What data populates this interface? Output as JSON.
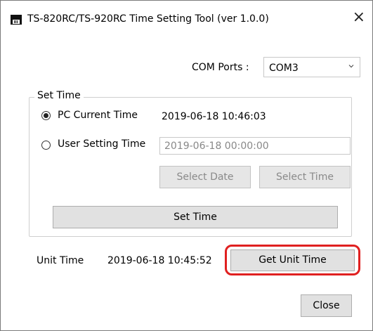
{
  "window": {
    "title": "TS-820RC/TS-920RC Time Setting Tool (ver 1.0.0)",
    "close_glyph": "×"
  },
  "com": {
    "label": "COM Ports :",
    "selected": "COM3"
  },
  "set_time": {
    "legend": "Set Time",
    "pc_current": {
      "label": "PC Current Time",
      "value": "2019-06-18 10:46:03",
      "checked": true
    },
    "user_setting": {
      "label": "User Setting Time",
      "value": "2019-06-18 00:00:00",
      "checked": false
    },
    "select_date_label": "Select Date",
    "select_time_label": "Select Time",
    "set_time_button_label": "Set Time"
  },
  "unit": {
    "label": "Unit Time",
    "value": "2019-06-18 10:45:52",
    "get_button_label": "Get Unit Time"
  },
  "close_button_label": "Close",
  "colors": {
    "highlight": "#e02020"
  },
  "icons": {
    "app": "app-calendar-icon",
    "combo": "chevron-down-icon",
    "close": "close-icon"
  }
}
